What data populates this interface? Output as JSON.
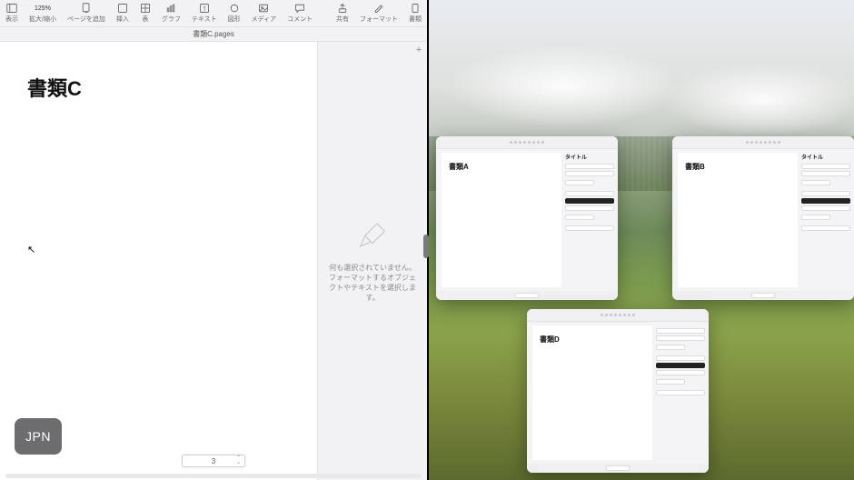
{
  "left": {
    "toolbar": {
      "view": {
        "label": "表示"
      },
      "zoom": {
        "value": "125%",
        "label": "拡大/縮小"
      },
      "addPage": {
        "label": "ページを追加"
      },
      "insert": {
        "label": "挿入"
      },
      "table": {
        "label": "表"
      },
      "chart": {
        "label": "グラフ"
      },
      "text": {
        "label": "テキスト"
      },
      "shape": {
        "label": "図形"
      },
      "media": {
        "label": "メディア"
      },
      "comment": {
        "label": "コメント"
      },
      "share": {
        "label": "共有"
      },
      "format": {
        "label": "フォーマット"
      },
      "document": {
        "label": "書類"
      }
    },
    "documentTitle": "書類C.pages",
    "page": {
      "heading": "書類C"
    },
    "inspector": {
      "line1": "何も選択されていません。",
      "line2": "フォーマットするオブジェクトやテキストを選択します。"
    },
    "addTabGlyph": "+",
    "pageStepper": "3",
    "langPill": "JPN"
  },
  "right": {
    "windows": {
      "a": {
        "heading": "書類A",
        "inspectorHeader": "タイトル"
      },
      "b": {
        "heading": "書類B",
        "inspectorHeader": "タイトル"
      },
      "d": {
        "heading": "書類D",
        "inspectorHeader": ""
      }
    }
  }
}
